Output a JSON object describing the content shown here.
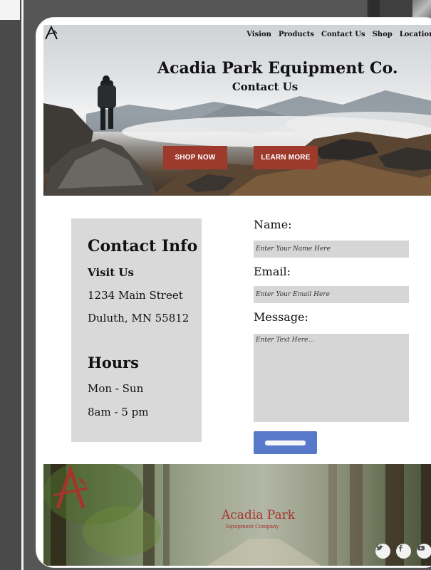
{
  "header": {
    "nav": [
      "Vision",
      "Products",
      "Contact Us",
      "Shop",
      "Locations"
    ]
  },
  "hero": {
    "title": "Acadia Park Equipment Co.",
    "subtitle": "Contact Us",
    "shop_label": "SHOP NOW",
    "learn_label": "LEARN MORE"
  },
  "contact": {
    "title": "Contact  Info",
    "visit_label": "Visit Us",
    "street": "1234 Main Street",
    "city": "Duluth, MN  55812",
    "hours_label": "Hours",
    "days": "Mon - Sun",
    "time": "8am - 5 pm"
  },
  "form": {
    "name_label": "Name:",
    "name_placeholder": "Enter Your Name Here",
    "email_label": "Email:",
    "email_placeholder": "Enter Your Email Here",
    "message_label": "Message:",
    "message_placeholder": "Enter Text Here..."
  },
  "footer": {
    "brand": "Acadia Park",
    "tagline": "Equipment Company",
    "social_icons": [
      "twitter-icon",
      "facebook-icon",
      "youtube-icon"
    ]
  },
  "colors": {
    "accent_red": "#9e3a2c",
    "submit_blue": "#5878c9",
    "panel_gray": "#d9d9d9",
    "brand_red": "#a5342b"
  }
}
